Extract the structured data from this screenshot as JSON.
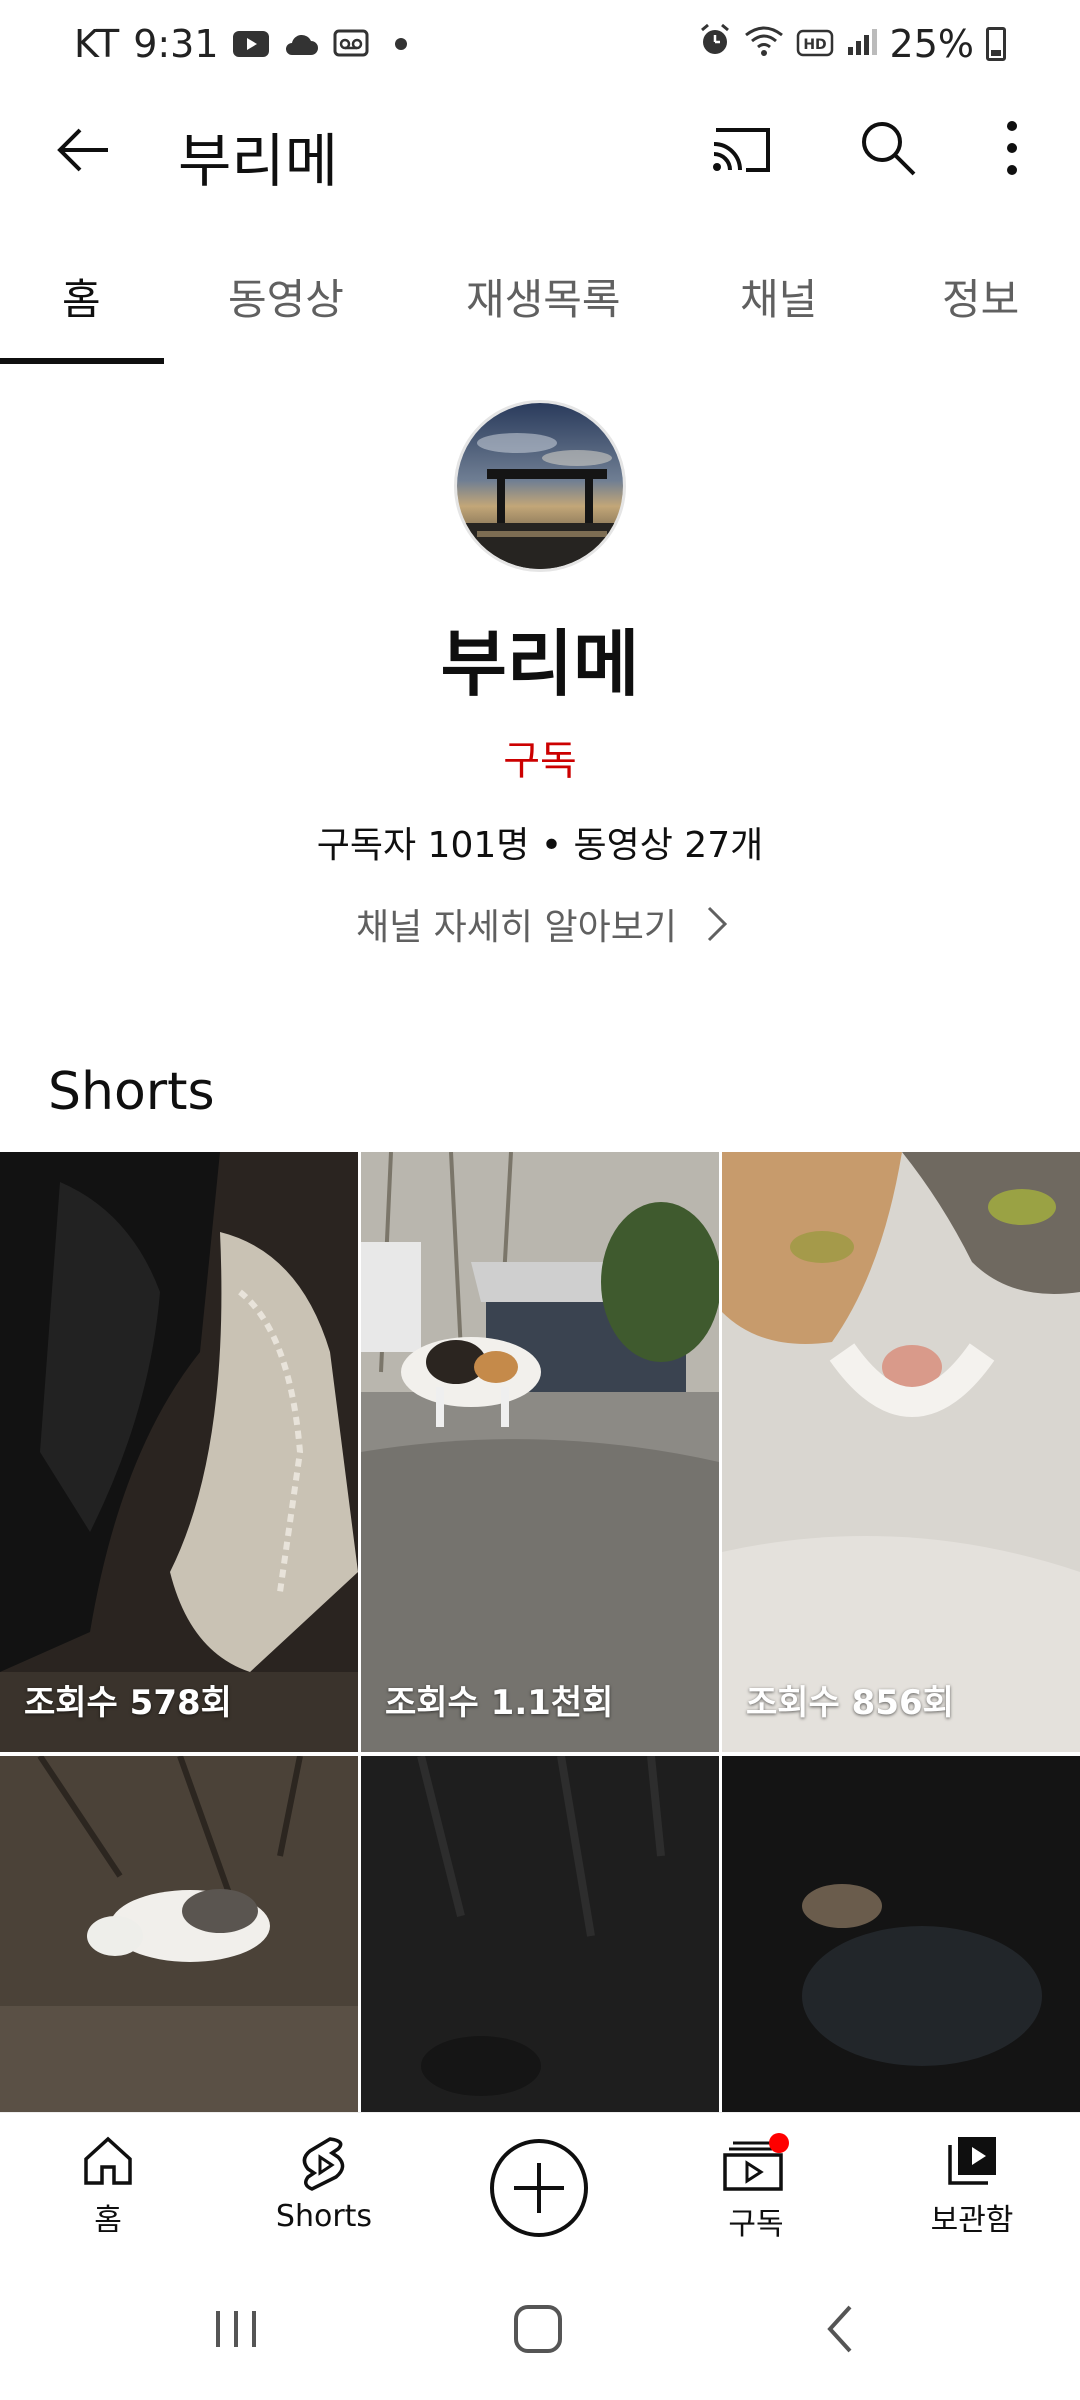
{
  "status_bar": {
    "carrier": "KT",
    "time": "9:31",
    "battery": "25%"
  },
  "app_bar": {
    "title": "부리메"
  },
  "tabs": [
    {
      "label": "홈",
      "active": true
    },
    {
      "label": "동영상"
    },
    {
      "label": "재생목록"
    },
    {
      "label": "채널"
    },
    {
      "label": "정보"
    }
  ],
  "channel": {
    "name": "부리메",
    "subscribe_label": "구독",
    "stats": "구독자 101명 • 동영상 27개",
    "more_info": "채널 자세히 알아보기"
  },
  "shorts": {
    "section_title": "Shorts",
    "items": [
      {
        "views": "조회수 578회"
      },
      {
        "views": "조회수 1.1천회"
      },
      {
        "views": "조회수 856회"
      },
      {
        "views": ""
      },
      {
        "views": ""
      },
      {
        "views": ""
      }
    ]
  },
  "bottom_nav": {
    "home": "홈",
    "shorts": "Shorts",
    "subscriptions": "구독",
    "library": "보관함"
  },
  "colors": {
    "accent_red": "#cc0000",
    "notification_dot": "#ff0000"
  }
}
